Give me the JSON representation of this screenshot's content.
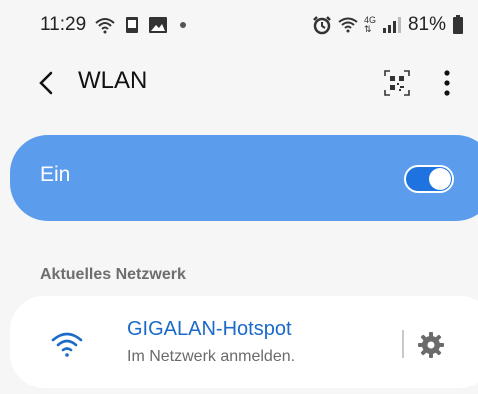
{
  "status": {
    "time": "11:29",
    "network_type": "4G",
    "battery": "81%"
  },
  "app_bar": {
    "title": "WLAN"
  },
  "master_toggle": {
    "label": "Ein",
    "state": "on",
    "card_color": "#5b9ced",
    "switch_color": "#1e73e0"
  },
  "section": {
    "current_network_label": "Aktuelles Netzwerk"
  },
  "current_network": {
    "name": "GIGALAN-Hotspot",
    "status": "Im Netzwerk anmelden.",
    "name_color": "#1b6ac9"
  },
  "icons": [
    "wifi-icon",
    "notification-icon",
    "image-icon",
    "alarm-icon",
    "signal-icon",
    "battery-icon",
    "back-icon",
    "qr-icon",
    "more-icon",
    "settings-gear-icon"
  ]
}
